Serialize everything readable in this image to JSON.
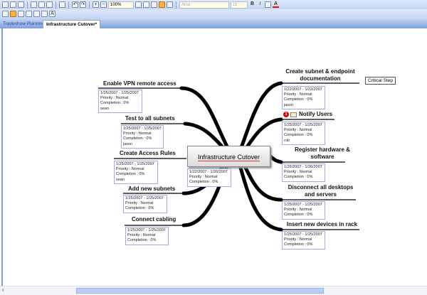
{
  "toolbar": {
    "zoom": "100%",
    "font": "Arial",
    "size": "11",
    "bold": "B",
    "italic": "I",
    "text_style": "A"
  },
  "tabs": [
    {
      "label": "Tradeshow Planning*"
    },
    {
      "label": "Infrastructure Cutover*"
    }
  ],
  "center": {
    "title": "Infrastructure Cutover",
    "dates": "1/22/2007 - 1/26/2007",
    "priority": "Priority : Normal",
    "completion": "Completion : 0%"
  },
  "callout": "Critical Step",
  "topics": [
    {
      "title": "Enable VPN remote access",
      "dates": "1/25/2007 - 1/25/2007",
      "priority": "Priority : Normal",
      "completion": "Completion : 0%",
      "owner": "sean"
    },
    {
      "title": "Test to all subnets",
      "dates": "1/25/2007 - 1/25/2007",
      "priority": "Priority : Normal",
      "completion": "Completion : 0%",
      "owner": "jason"
    },
    {
      "title": "Create Access Rules",
      "dates": "1/25/2007 - 1/25/2007",
      "priority": "Priority : Normal",
      "completion": "Completion : 0%",
      "owner": "sean"
    },
    {
      "title": "Add new subnets",
      "dates": "1/25/2007 - 1/25/2007",
      "priority": "Priority : Normal",
      "completion": "Completion : 0%"
    },
    {
      "title": "Connect cabling",
      "dates": "1/25/2007 - 1/25/2007",
      "priority": "Priority : Normal",
      "completion": "Completion : 0%"
    },
    {
      "title": "Create subnet & endpoint documentation",
      "dates": "1/22/2007 - 1/22/2007",
      "priority": "Priority : Normal",
      "completion": "Completion : 0%",
      "owner": "jason"
    },
    {
      "title": "Notify Users",
      "dates": "1/25/2007 - 1/25/2007",
      "priority": "Priority : Normal",
      "completion": "Completion : 0%",
      "owner": "rob",
      "priority_badge": "1"
    },
    {
      "title": "Register hardware & software",
      "dates": "1/26/2007 - 1/26/2007",
      "priority": "Priority : Normal",
      "completion": "Completion : 0%"
    },
    {
      "title": "Disconnect all desktops and servers",
      "dates": "1/25/2007 - 1/25/2007",
      "priority": "Priority : Normal",
      "completion": "Completion : 0%"
    },
    {
      "title": "Insert new devices in rack",
      "dates": "1/25/2007 - 1/25/2007",
      "priority": "Priority : Normal",
      "completion": "Completion : 0%"
    }
  ]
}
